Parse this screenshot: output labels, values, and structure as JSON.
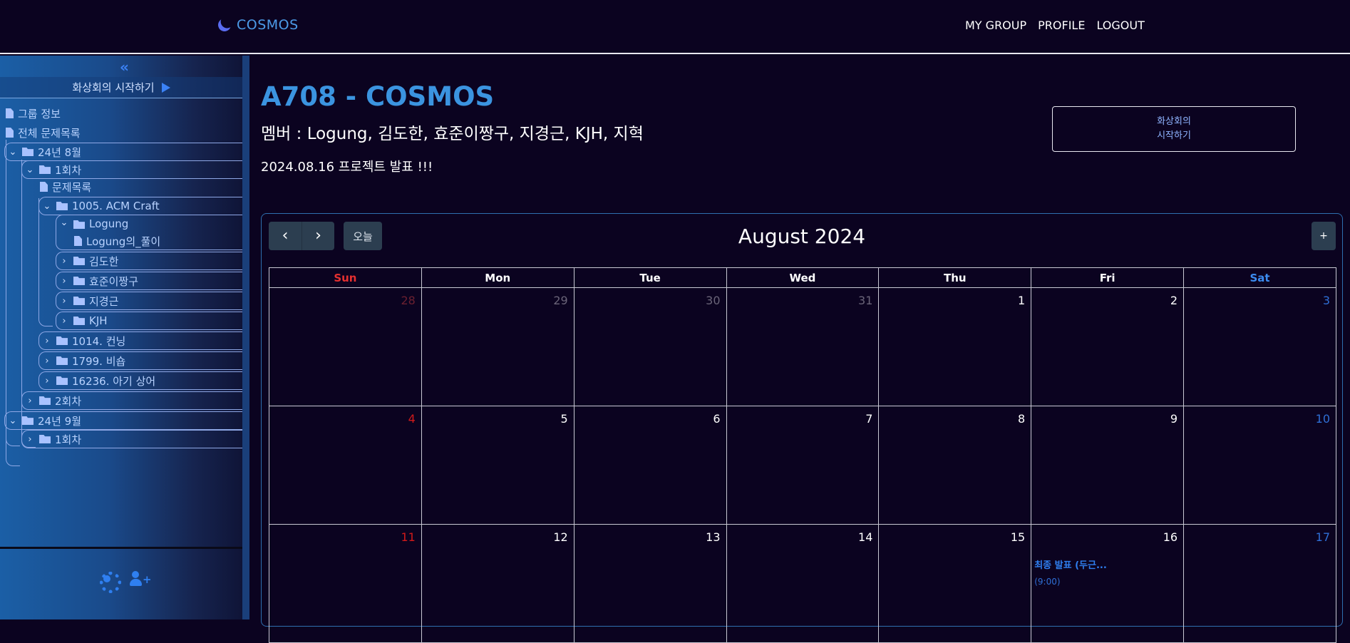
{
  "header": {
    "logo_text": "COSMOS",
    "nav": [
      "MY GROUP",
      "PROFILE",
      "LOGOUT"
    ]
  },
  "sidebar": {
    "collapse_glyph": "«",
    "start_vc_label": "화상회의 시작하기",
    "items": [
      {
        "label": "그룹 정보",
        "icon": "file-icon"
      },
      {
        "label": "전체 문제목록",
        "icon": "file-icon"
      },
      {
        "label": "24년 8월",
        "icon": "folder-icon"
      },
      {
        "label": "1회차",
        "icon": "folder-icon"
      },
      {
        "label": "문제목록",
        "icon": "file-icon"
      },
      {
        "label": "1005. ACM Craft",
        "icon": "folder-icon"
      },
      {
        "label": "Logung",
        "icon": "folder-icon"
      },
      {
        "label": "Logung의_풀이",
        "icon": "file-icon"
      },
      {
        "label": "김도한",
        "icon": "folder-icon"
      },
      {
        "label": "효준이짱구",
        "icon": "folder-icon"
      },
      {
        "label": "지경근",
        "icon": "folder-icon"
      },
      {
        "label": "KJH",
        "icon": "folder-icon"
      },
      {
        "label": "1014. 컨닝",
        "icon": "folder-icon"
      },
      {
        "label": "1799. 비숍",
        "icon": "folder-icon"
      },
      {
        "label": "16236. 아기 상어",
        "icon": "folder-icon"
      },
      {
        "label": "2회차",
        "icon": "folder-icon"
      },
      {
        "label": "24년 9월",
        "icon": "folder-icon"
      },
      {
        "label": "1회차",
        "icon": "folder-icon"
      }
    ]
  },
  "main": {
    "group_title": "A708 - COSMOS",
    "members": "멤버 : Logung, 김도한, 효준이짱구, 지경근, KJH, 지혁",
    "announcement": "2024.08.16 프로젝트 발표 !!!",
    "vc_button_line1": "화상회의",
    "vc_button_line2": "시작하기"
  },
  "calendar": {
    "title": "August 2024",
    "today_label": "오늘",
    "add_label": "+",
    "weekdays": [
      "Sun",
      "Mon",
      "Tue",
      "Wed",
      "Thu",
      "Fri",
      "Sat"
    ],
    "weeks": [
      [
        "28",
        "29",
        "30",
        "31",
        "1",
        "2",
        "3"
      ],
      [
        "4",
        "5",
        "6",
        "7",
        "8",
        "9",
        "10"
      ],
      [
        "11",
        "12",
        "13",
        "14",
        "15",
        "16",
        "17"
      ]
    ],
    "event": {
      "title": "최종 발표 (두근...",
      "time": "(9:00)"
    }
  }
}
